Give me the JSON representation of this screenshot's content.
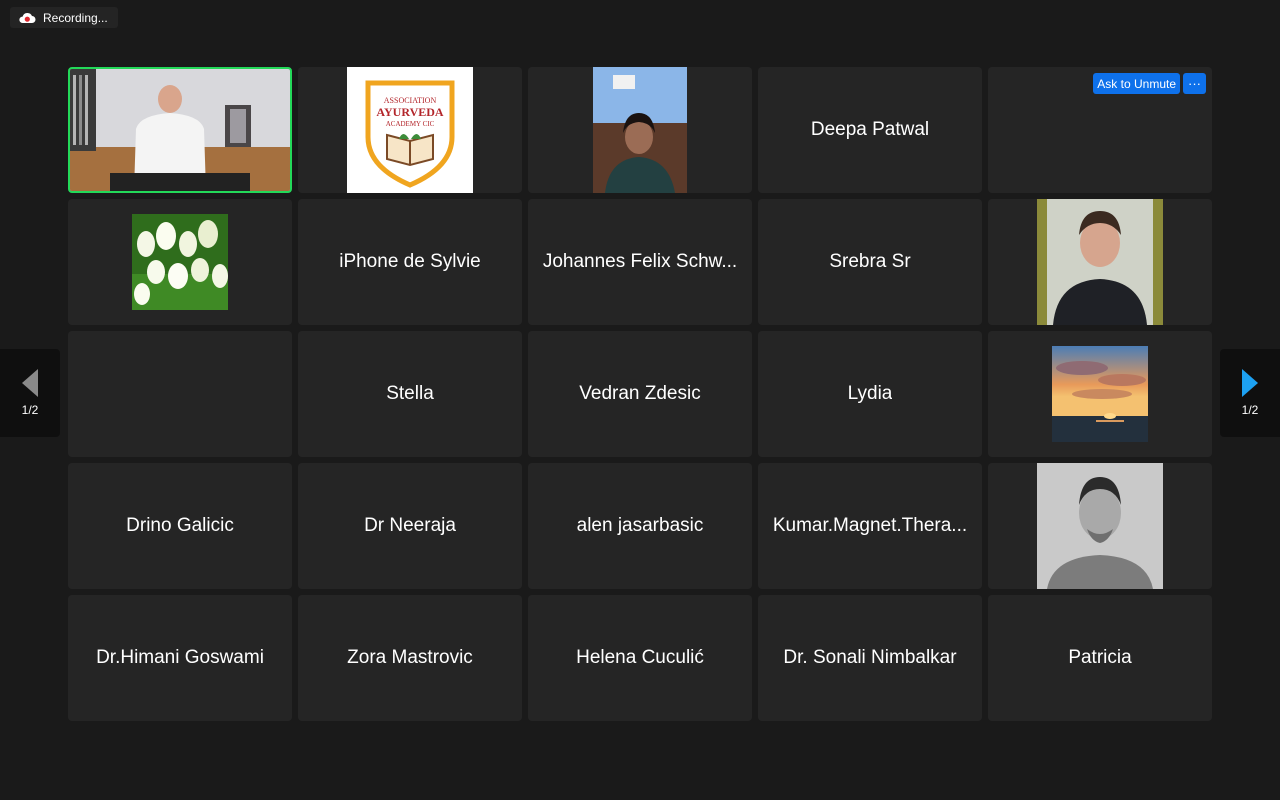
{
  "recording": {
    "label": "Recording...",
    "icon": "cloud-record-icon"
  },
  "paging": {
    "prev_label": "1/2",
    "next_label": "1/2"
  },
  "tile_actions": {
    "unmute_label": "Ask to Unmute",
    "more_label": "···"
  },
  "colors": {
    "background": "#1a1a1a",
    "tile": "#252525",
    "active_speaker": "#23d959",
    "accent_blue": "#0e71eb",
    "next_arrow": "#1da1f2",
    "prev_arrow": "#8a8a8a"
  },
  "participants": [
    {
      "name": "",
      "kind": "video",
      "active": true
    },
    {
      "name": "",
      "kind": "logo",
      "logo_text": [
        "ASSOCIATION",
        "AYURVEDA",
        "ACADEMY CIC"
      ]
    },
    {
      "name": "",
      "kind": "video"
    },
    {
      "name": "Deepa Patwal",
      "kind": "name"
    },
    {
      "name": "",
      "kind": "empty",
      "has_unmute": true
    },
    {
      "name": "",
      "kind": "picture-tulips"
    },
    {
      "name": "iPhone de Sylvie",
      "kind": "name"
    },
    {
      "name": "Johannes Felix Schw...",
      "kind": "name"
    },
    {
      "name": "Srebra Sr",
      "kind": "name"
    },
    {
      "name": "",
      "kind": "video"
    },
    {
      "name": "",
      "kind": "empty"
    },
    {
      "name": "Stella",
      "kind": "name"
    },
    {
      "name": "Vedran Zdesic",
      "kind": "name"
    },
    {
      "name": "Lydia",
      "kind": "name"
    },
    {
      "name": "",
      "kind": "picture-sunset"
    },
    {
      "name": "Drino Galicic",
      "kind": "name"
    },
    {
      "name": "Dr Neeraja",
      "kind": "name"
    },
    {
      "name": "alen jasarbasic",
      "kind": "name"
    },
    {
      "name": "Kumar.Magnet.Thera...",
      "kind": "name"
    },
    {
      "name": "",
      "kind": "picture-portrait"
    },
    {
      "name": "Dr.Himani Goswami",
      "kind": "name"
    },
    {
      "name": "Zora Mastrovic",
      "kind": "name"
    },
    {
      "name": "Helena Cuculić",
      "kind": "name"
    },
    {
      "name": "Dr. Sonali Nimbalkar",
      "kind": "name"
    },
    {
      "name": "Patricia",
      "kind": "name"
    }
  ]
}
